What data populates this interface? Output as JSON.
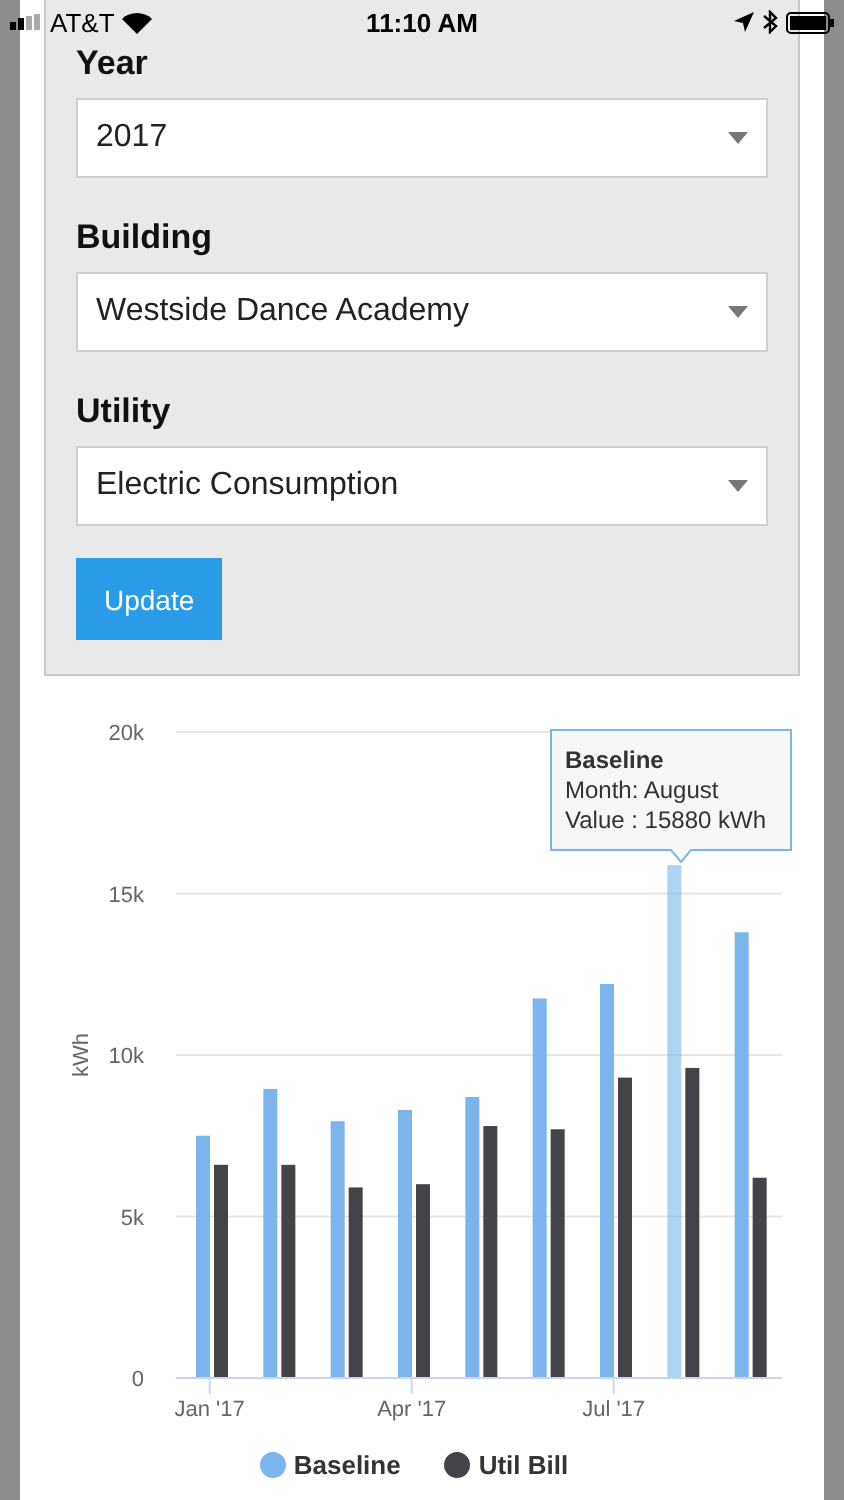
{
  "status_bar": {
    "carrier": "AT&T",
    "time": "11:10 AM"
  },
  "filters": [
    {
      "label": "Year",
      "value": "2017"
    },
    {
      "label": "Building",
      "value": "Westside Dance Academy"
    },
    {
      "label": "Utility",
      "value": "Electric Consumption"
    }
  ],
  "update_button": "Update",
  "chart": {
    "chart_data": {
      "type": "bar",
      "legend": "bottom",
      "ylabel": "kWh",
      "grid": true,
      "ylim": [
        0,
        20000
      ],
      "yticks": [
        {
          "value": 0,
          "label": "0"
        },
        {
          "value": 5000,
          "label": "5k"
        },
        {
          "value": 10000,
          "label": "10k"
        },
        {
          "value": 15000,
          "label": "15k"
        },
        {
          "value": 20000,
          "label": "20k"
        }
      ],
      "categories": [
        "Jan '17",
        null,
        null,
        "Apr '17",
        null,
        null,
        "Jul '17",
        null,
        null
      ],
      "series": [
        {
          "name": "Baseline",
          "color": "#7cb5ec",
          "values": [
            7500,
            8950,
            7950,
            8300,
            8700,
            11750,
            12200,
            15880,
            13800
          ]
        },
        {
          "name": "Util Bill",
          "color": "#434348",
          "values": [
            6600,
            6600,
            5900,
            6000,
            7800,
            7700,
            9300,
            9600,
            6200
          ]
        }
      ]
    },
    "hover_series": [
      {
        "selected": true
      },
      {
        "selected": false
      }
    ],
    "hover_months": [
      {
        "selected": false
      },
      {
        "selected": false
      },
      {
        "selected": false
      },
      {
        "selected": false
      },
      {
        "selected": false
      },
      {
        "selected": false
      },
      {
        "selected": false
      },
      {
        "selected": true
      },
      {
        "selected": false
      }
    ],
    "tooltip": {
      "title": "Baseline",
      "lines": [
        "Month: August",
        "Value : 15880 kWh"
      ]
    }
  }
}
